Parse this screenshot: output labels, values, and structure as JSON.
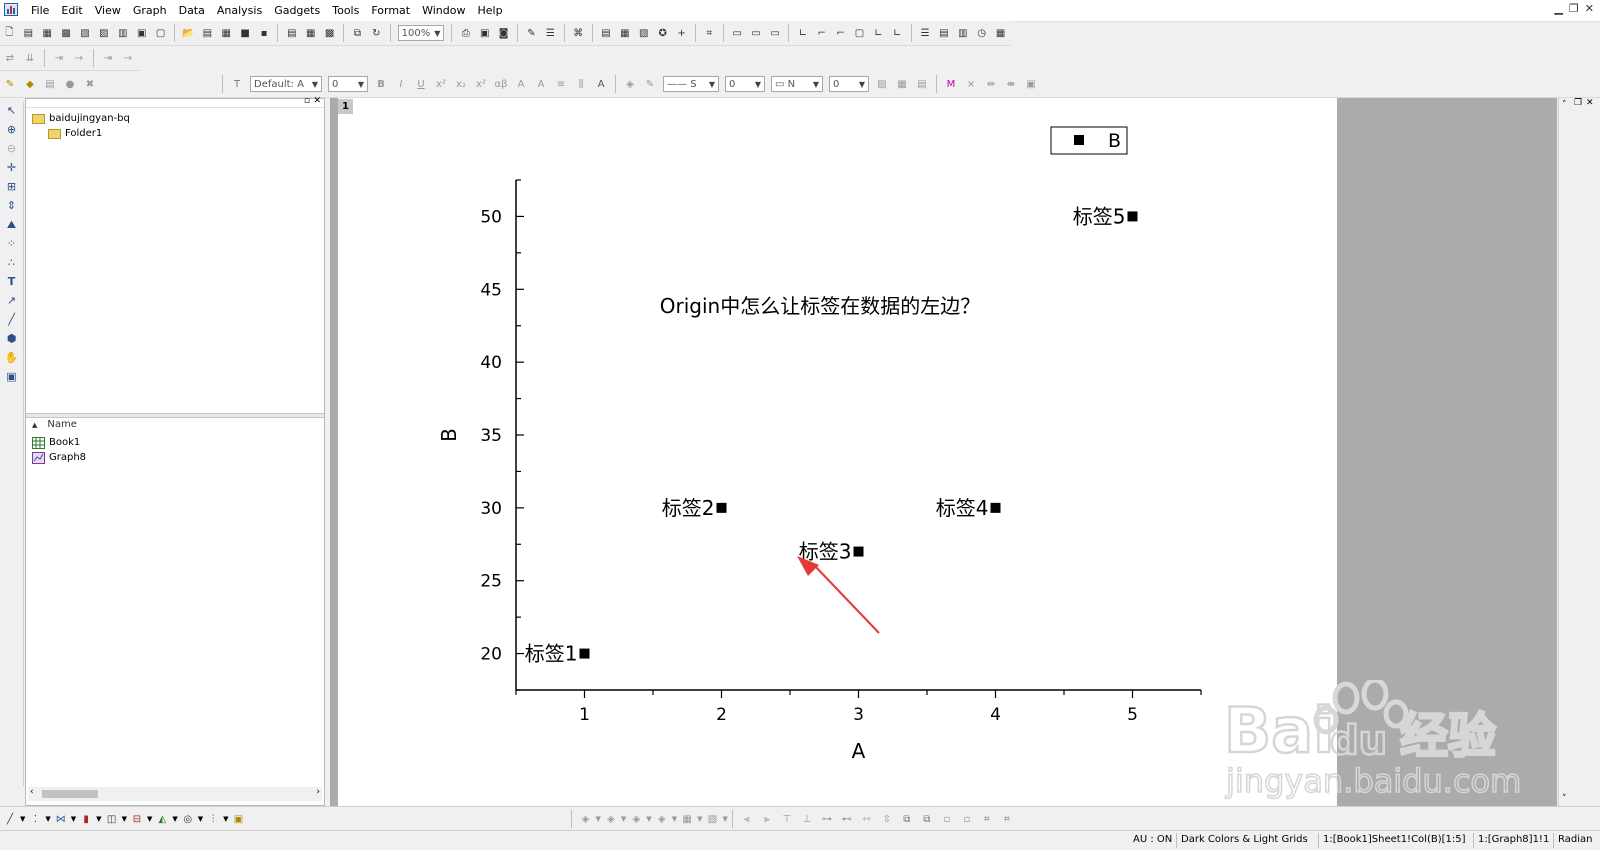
{
  "menubar": {
    "items": [
      "File",
      "Edit",
      "View",
      "Graph",
      "Data",
      "Analysis",
      "Gadgets",
      "Tools",
      "Format",
      "Window",
      "Help"
    ]
  },
  "toolbar": {
    "zoom": "100%",
    "font_name": "Default: A",
    "font_size": "0",
    "line_style": "S",
    "line_width": "0",
    "pattern": "N",
    "pattern_width": "0"
  },
  "explorer": {
    "tree": [
      {
        "label": "baidujingyan-bq",
        "level": 0
      },
      {
        "label": "Folder1",
        "level": 1
      }
    ],
    "column_header": "Name",
    "files": [
      {
        "label": "Book1",
        "icon": "workbook-icon"
      },
      {
        "label": "Graph8",
        "icon": "graph-icon"
      }
    ]
  },
  "graph": {
    "page_tab": "1",
    "annotation_title": "Origin中怎么让标签在数据的左边？",
    "legend_label": "B",
    "arrow_color": "#e53935"
  },
  "chart_data": {
    "type": "scatter",
    "title": "",
    "xlabel": "A",
    "ylabel": "B",
    "xlim": [
      0.5,
      5.5
    ],
    "ylim": [
      17.5,
      52.5
    ],
    "xticks": [
      "1",
      "2",
      "3",
      "4",
      "5"
    ],
    "yticks": [
      "20",
      "25",
      "30",
      "35",
      "40",
      "45",
      "50"
    ],
    "legend_placement": "top-right",
    "grid": false,
    "series": [
      {
        "name": "B",
        "x": [
          1,
          2,
          3,
          4,
          5
        ],
        "y": [
          20,
          30,
          27,
          30,
          50
        ],
        "point_labels": [
          "标签1",
          "标签2",
          "标签3",
          "标签4",
          "标签5"
        ]
      }
    ]
  },
  "statusbar": {
    "au": "AU : ON",
    "theme": "Dark Colors & Light Grids",
    "cell": "1:[Book1]Sheet1!Col(B)[1:5]",
    "layer": "1:[Graph8]1!1",
    "angle": "Radian"
  },
  "watermark": {
    "brand_latin": "Bai",
    "brand_du": "du",
    "brand_cn": "经验",
    "url": "jingyan.baidu.com"
  }
}
